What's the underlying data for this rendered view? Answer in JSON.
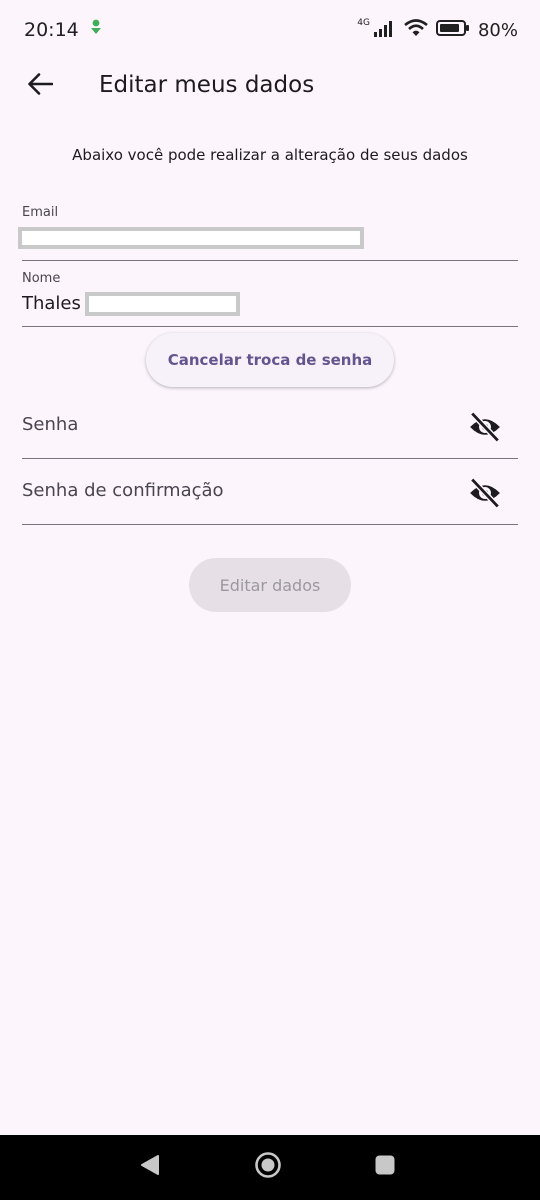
{
  "status_bar": {
    "time": "20:14",
    "network_type": "4G",
    "battery": "80%",
    "icons": [
      "download-icon",
      "signal-icon",
      "wifi-icon",
      "battery-icon"
    ]
  },
  "app_bar": {
    "title": "Editar meus dados",
    "back_icon": "arrow-left-icon"
  },
  "intro_text": "Abaixo você pode realizar a alteração de seus dados",
  "form": {
    "email": {
      "label": "Email",
      "value": ""
    },
    "name": {
      "label": "Nome",
      "value": "Thales"
    },
    "cancel_password_change": "Cancelar troca de senha",
    "password": {
      "label": "Senha",
      "visibility_icon": "eye-off-icon"
    },
    "password_confirm": {
      "label": "Senha de confirmação",
      "visibility_icon": "eye-off-icon"
    },
    "submit_label": "Editar dados"
  },
  "colors": {
    "background": "#fcf5fc",
    "accent": "#65558f",
    "disabled_button": "#e6e0e6"
  },
  "nav_bar": {
    "icons": [
      "back-triangle-icon",
      "home-circle-icon",
      "recents-square-icon"
    ]
  }
}
